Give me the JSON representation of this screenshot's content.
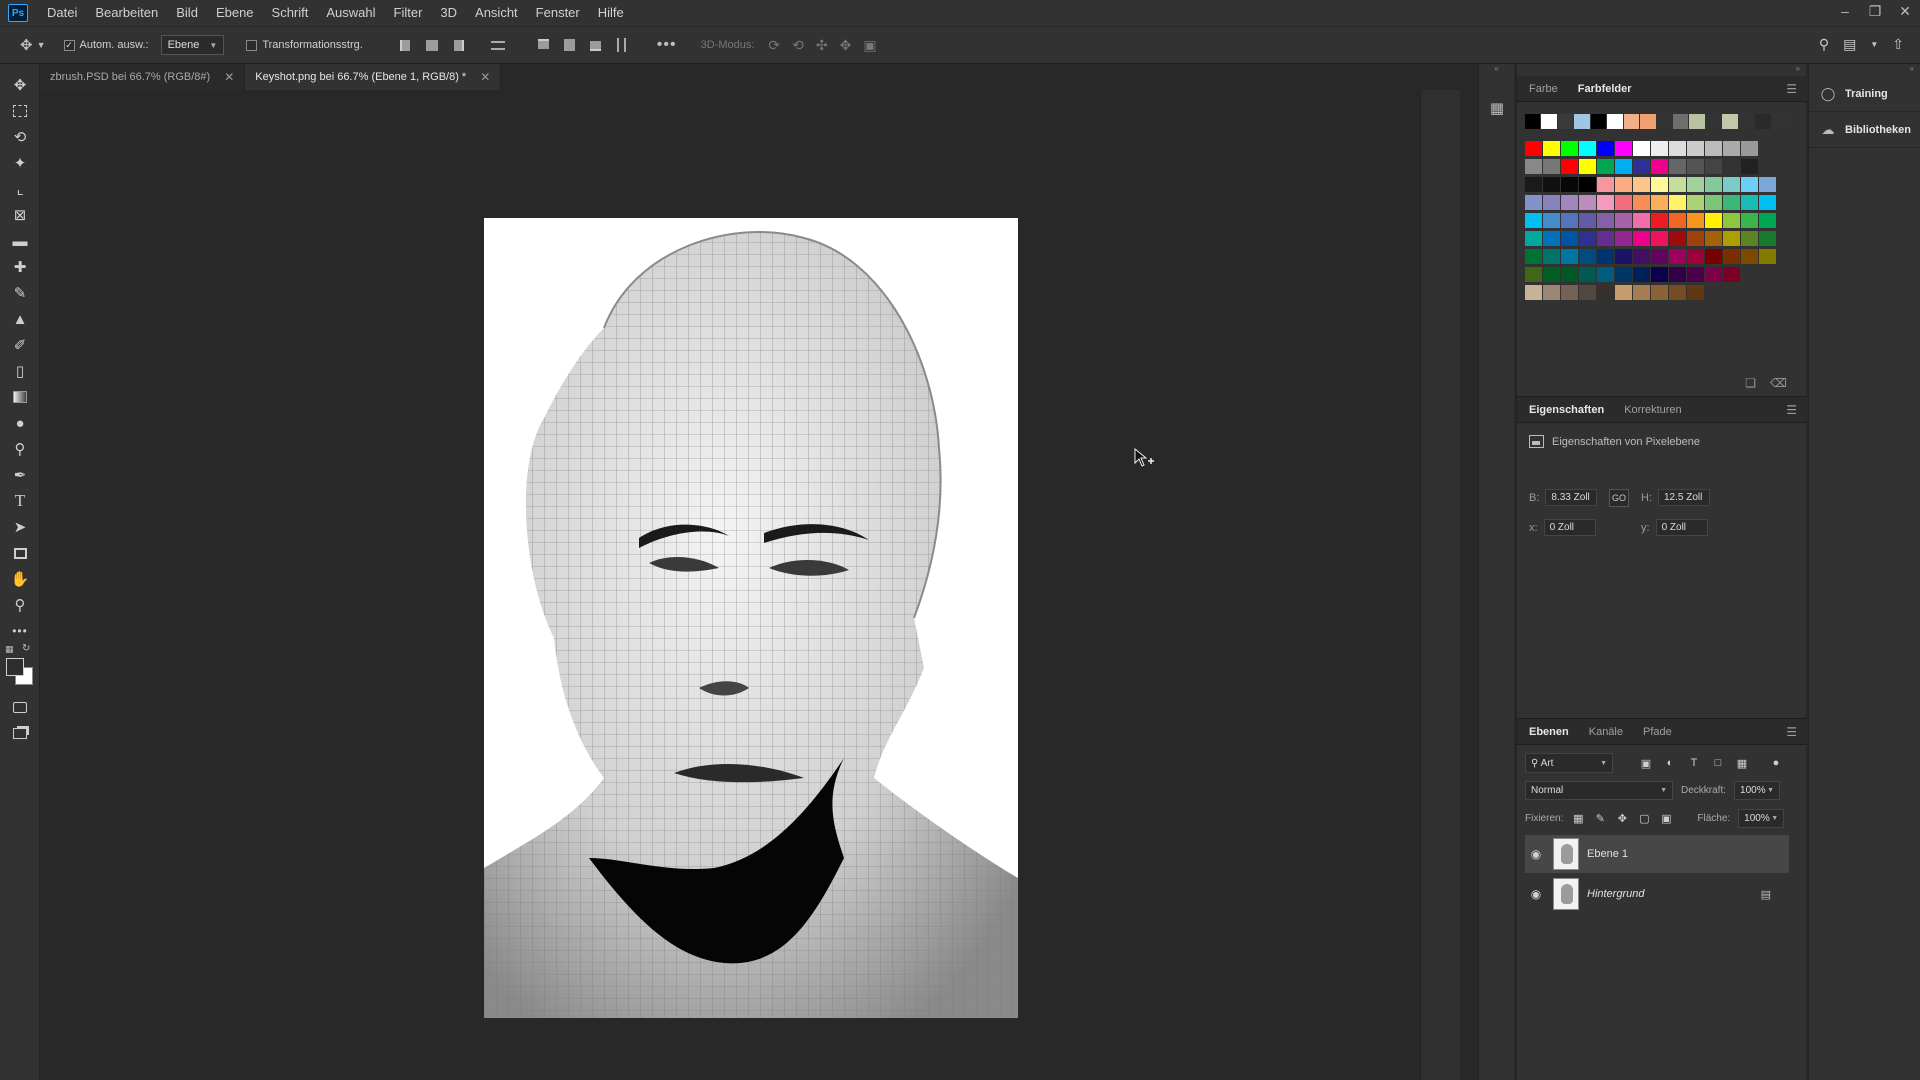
{
  "menu": {
    "logo": "Ps",
    "items": [
      "Datei",
      "Bearbeiten",
      "Bild",
      "Ebene",
      "Schrift",
      "Auswahl",
      "Filter",
      "3D",
      "Ansicht",
      "Fenster",
      "Hilfe"
    ]
  },
  "options": {
    "auto_select_label": "Autom. ausw.:",
    "auto_select_target": "Ebene",
    "transform_label": "Transformationsstrg.",
    "mode_3d_label": "3D-Modus:"
  },
  "tabs": [
    {
      "label": "zbrush.PSD bei 66.7% (RGB/8#)",
      "active": false
    },
    {
      "label": "Keyshot.png bei 66.7% (Ebene 1, RGB/8) *",
      "active": true
    }
  ],
  "swatches_panel": {
    "tabs": [
      "Farbe",
      "Farbfelder"
    ],
    "active_tab": "Farbfelder",
    "rows": [
      [
        "#000000",
        "#ffffff",
        "#3a3a3a",
        "#9fc6e3",
        "#000000",
        "#ffffff",
        "#f2b08a",
        "#f0a070",
        "#333333",
        "#6e6e6e",
        "#b8c2a0",
        "#333333",
        "#c3c7a9",
        "#333333",
        "#2a2a2a",
        "#333333"
      ],
      [
        "#ff0000",
        "#ffff00",
        "#00ff00",
        "#00ffff",
        "#0000ff",
        "#ff00ff",
        "#ffffff",
        "#eeeeee",
        "#dddddd",
        "#cccccc",
        "#bbbbbb",
        "#aaaaaa",
        "#999999"
      ],
      [
        "#888888",
        "#777777",
        "#ff0000",
        "#ffff00",
        "#00a651",
        "#00aeef",
        "#2e3192",
        "#ec008c",
        "#666666",
        "#555555",
        "#444444",
        "#333333",
        "#222222"
      ],
      [
        "#1a1a1a",
        "#111111",
        "#080808",
        "#000000",
        "#f5989d",
        "#f9ad81",
        "#fdc689",
        "#fff79a",
        "#c4df9b",
        "#a2d39c",
        "#82ca9c",
        "#7accc8",
        "#6dcff6",
        "#7da7d9"
      ],
      [
        "#8393ca",
        "#8882be",
        "#a187be",
        "#bc8cbf",
        "#f49ac1",
        "#f26c7d",
        "#f68e56",
        "#fbaf5d",
        "#fff467",
        "#acd373",
        "#7cc576",
        "#3bb878",
        "#1abbb4",
        "#00bff3"
      ],
      [
        "#00bff3",
        "#448ccb",
        "#5674b9",
        "#605ca8",
        "#855fa8",
        "#a763a8",
        "#f06eaa",
        "#ed1c24",
        "#f26522",
        "#f7941d",
        "#fff200",
        "#8dc63f",
        "#39b54a",
        "#00a651"
      ],
      [
        "#00a99d",
        "#0072bc",
        "#0054a6",
        "#2e3192",
        "#662d91",
        "#92278f",
        "#ec008c",
        "#ed145b",
        "#9e0b0f",
        "#a0410d",
        "#a36209",
        "#aba000",
        "#598527",
        "#1a7b30"
      ],
      [
        "#007236",
        "#00746b",
        "#0076a3",
        "#004b80",
        "#003471",
        "#1b1464",
        "#440e62",
        "#630460",
        "#9e005d",
        "#9e0039",
        "#790000",
        "#7b2e00",
        "#7d4900",
        "#827b00"
      ],
      [
        "#406618",
        "#005e20",
        "#005826",
        "#005952",
        "#005b7f",
        "#003663",
        "#002157",
        "#0d004c",
        "#32004b",
        "#4b0049",
        "#7b0046",
        "#7a0026"
      ],
      [
        "#c7b299",
        "#998675",
        "#736357",
        "#534741",
        "#37302d",
        "#c69c6d",
        "#a67c52",
        "#8c6239",
        "#754c24",
        "#603913"
      ]
    ]
  },
  "properties_panel": {
    "tabs": [
      "Eigenschaften",
      "Korrekturen"
    ],
    "active_tab": "Eigenschaften",
    "subtitle": "Eigenschaften von Pixelebene",
    "w_label": "B:",
    "w_value": "8.33 Zoll",
    "link_label": "GO",
    "h_label": "H:",
    "h_value": "12.5 Zoll",
    "x_label": "x:",
    "x_value": "0 Zoll",
    "y_label": "y:",
    "y_value": "0 Zoll"
  },
  "layers_panel": {
    "tabs": [
      "Ebenen",
      "Kanäle",
      "Pfade"
    ],
    "active_tab": "Ebenen",
    "filter_label": "Art",
    "blend_mode": "Normal",
    "opacity_label": "Deckkraft:",
    "opacity_value": "100%",
    "lock_label": "Fixieren:",
    "fill_label": "Fläche:",
    "fill_value": "100%",
    "layers": [
      {
        "name": "Ebene 1",
        "selected": true,
        "locked": false
      },
      {
        "name": "Hintergrund",
        "selected": false,
        "locked": true
      }
    ]
  },
  "far_right": {
    "items": [
      "Training",
      "Bibliotheken"
    ]
  }
}
